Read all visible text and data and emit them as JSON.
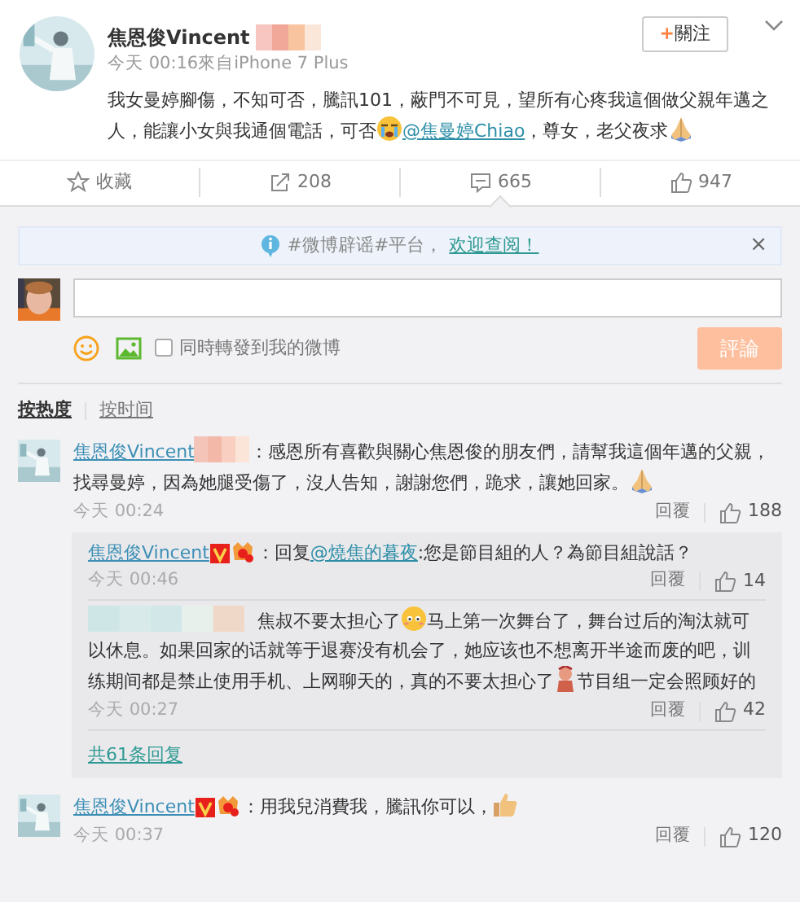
{
  "post": {
    "author": "焦恩俊Vincent",
    "follow_plus": "+",
    "follow_label": "關注",
    "meta": "今天 00:16來自iPhone 7 Plus",
    "body": [
      {
        "kind": "text",
        "text": "我女曼婷腳傷，不知可否，騰訊101，蔽門不可見，望所有心疼我這個做父親年邁之人，能讓小女與我通個電話，可否"
      },
      {
        "kind": "cry"
      },
      {
        "kind": "mention",
        "text": "@焦曼婷Chiao"
      },
      {
        "kind": "text",
        "text": "，尊女，老父夜求"
      },
      {
        "kind": "pray"
      }
    ]
  },
  "actions": [
    {
      "kind": "star",
      "label": "收藏",
      "selected": false
    },
    {
      "kind": "share",
      "label": "208",
      "selected": false
    },
    {
      "kind": "comment",
      "label": "665",
      "selected": true
    },
    {
      "kind": "like",
      "label": "947",
      "selected": false
    }
  ],
  "notice": {
    "text": "#微博辟谣#平台，",
    "link": "欢迎查阅！",
    "close": "×"
  },
  "composer": {
    "repost_label": "同時轉發到我的微博",
    "repost_checked": false,
    "submit": "評論",
    "submit_disabled": true
  },
  "sort": [
    {
      "label": "按热度",
      "selected": true
    },
    {
      "label": "按时间",
      "selected": false
    }
  ],
  "comments": [
    {
      "author": "焦恩俊Vincent",
      "verified": false,
      "medal": false,
      "blurred_tag": true,
      "body": [
        {
          "kind": "text",
          "text": "：感恩所有喜歡與關心焦恩俊的朋友們，請幫我這個年邁的父親，找尋曼婷，因為她腿受傷了，沒人告知，謝謝您們，跪求，讓她回家。"
        },
        {
          "kind": "pray"
        }
      ],
      "time": "今天 00:24",
      "reply": "回覆",
      "likes": "188",
      "replies": [
        {
          "author": "焦恩俊Vincent",
          "anonymous": false,
          "verified": true,
          "medal": true,
          "body": [
            {
              "kind": "text",
              "text": "：回复"
            },
            {
              "kind": "mention",
              "text": "@燒焦的暮夜"
            },
            {
              "kind": "text",
              "text": ":您是節目組的人？為節目組說話？"
            }
          ],
          "time": "今天 00:46",
          "reply": "回覆",
          "likes": "14"
        },
        {
          "anonymous": true,
          "verified": false,
          "medal": false,
          "body": [
            {
              "kind": "text",
              "text": "焦叔不要太担心了"
            },
            {
              "kind": "blush"
            },
            {
              "kind": "text",
              "text": "马上第一次舞台了，舞台过后的淘汰就可以休息。如果回家的话就等于退赛没有机会了，她应该也不想离开半途而废的吧，训练期间都是禁止使用手机、上网聊天的，真的不要太担心了"
            },
            {
              "kind": "figure"
            },
            {
              "kind": "text",
              "text": "节目组一定会照顾好的"
            }
          ],
          "time": "今天 00:27",
          "reply": "回覆",
          "likes": "42"
        }
      ],
      "more": "共61条回复"
    },
    {
      "author": "焦恩俊Vincent",
      "verified": true,
      "medal": true,
      "blurred_tag": false,
      "body": [
        {
          "kind": "text",
          "text": "：用我兒消費我，騰訊你可以，"
        },
        {
          "kind": "thumb"
        }
      ],
      "time": "今天 00:37",
      "reply": "回覆",
      "likes": "120"
    }
  ]
}
